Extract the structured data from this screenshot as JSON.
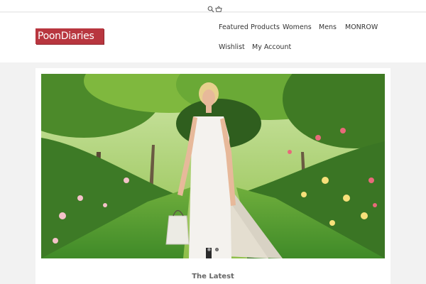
{
  "icons": {
    "search": "search-icon",
    "cart": "basket-icon"
  },
  "brand": {
    "name": "PoonDiaries",
    "color": "#b8363f"
  },
  "nav": {
    "items": [
      {
        "label": "Featured Products"
      },
      {
        "label": "Womens"
      },
      {
        "label": "Mens"
      },
      {
        "label": "MONROW"
      },
      {
        "label": "Wishlist"
      },
      {
        "label": "My Account"
      }
    ]
  },
  "slider": {
    "slide_count": 2,
    "active_index": 1
  },
  "section": {
    "title": "The Latest"
  }
}
